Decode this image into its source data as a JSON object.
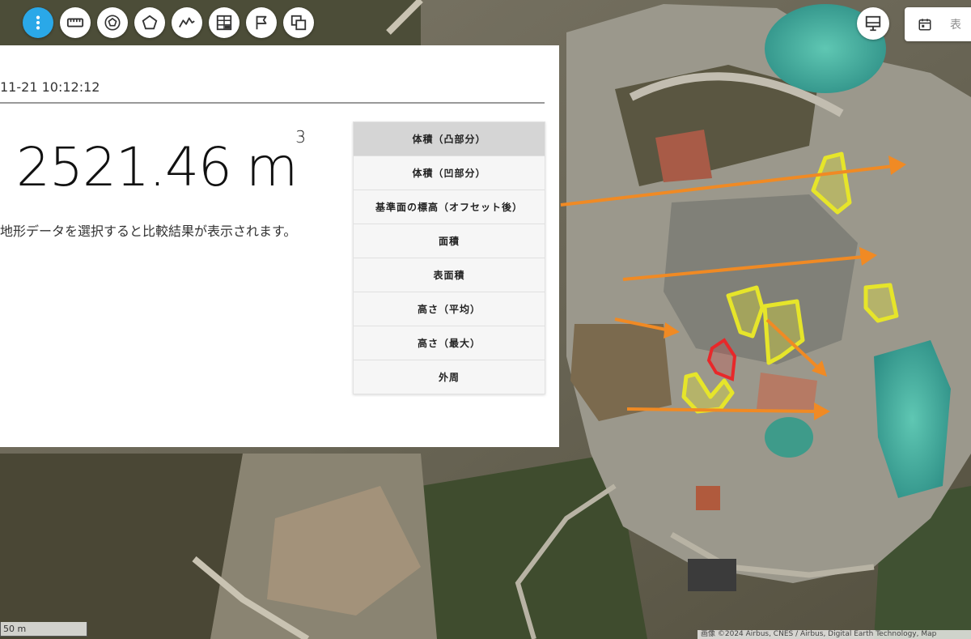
{
  "toolbar": {
    "buttons": [
      {
        "name": "menu-dots-icon",
        "active": true
      },
      {
        "name": "ruler-icon"
      },
      {
        "name": "pentagon-in-circle-icon"
      },
      {
        "name": "pentagon-icon"
      },
      {
        "name": "elevation-profile-icon"
      },
      {
        "name": "table-icon"
      },
      {
        "name": "flag-icon"
      },
      {
        "name": "copy-icon"
      }
    ]
  },
  "top_right": {
    "monitor_icon": "monitor-icon",
    "date_label": "表"
  },
  "panel": {
    "timestamp": "11-21 10:12:12",
    "value": "2521.46",
    "unit": "m",
    "unit_power": "3",
    "hint": "地形データを選択すると比較結果が表示されます。",
    "menu": [
      {
        "label": "体積（凸部分）",
        "selected": true
      },
      {
        "label": "体積（凹部分）"
      },
      {
        "label": "基準面の標高（オフセット後）"
      },
      {
        "label": "面積"
      },
      {
        "label": "表面積"
      },
      {
        "label": "高さ（平均）"
      },
      {
        "label": "高さ（最大）"
      },
      {
        "label": "外周"
      }
    ]
  },
  "map": {
    "scale_label": "50 m",
    "attribution": "画像 ©2024 Airbus, CNES / Airbus, Digital Earth Technology, Map",
    "colors": {
      "annotation_arrow": "#f08a24",
      "highlight_yellow": "#e6e52a",
      "highlight_red": "#e8282a",
      "accent_blue": "#2aa8e8"
    }
  }
}
